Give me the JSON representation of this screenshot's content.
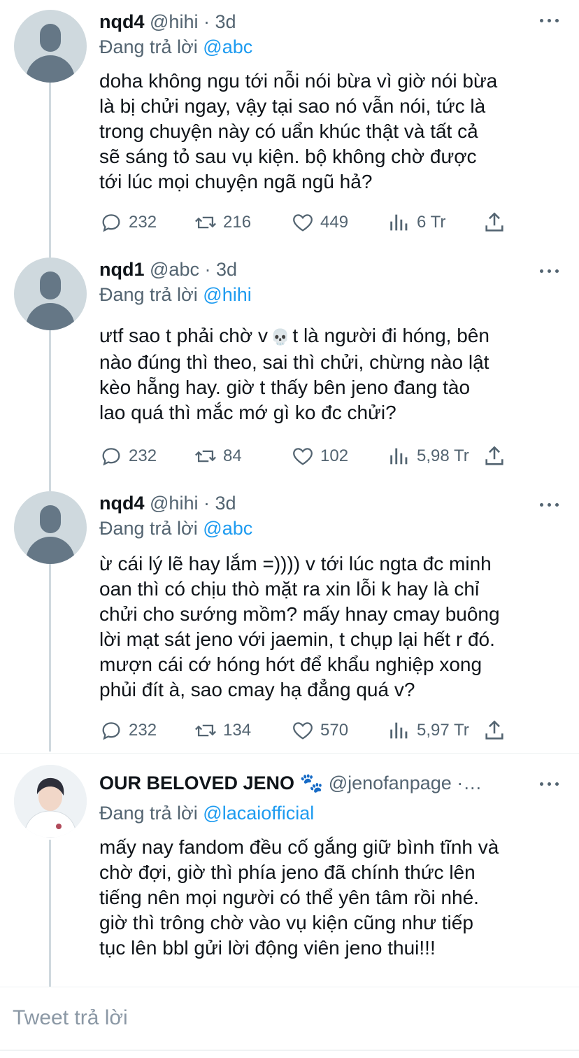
{
  "tweets": [
    {
      "name": "nqd4",
      "handle": "@hihi",
      "dot": "·",
      "time": "3d",
      "replying_prefix": "Đang trả lời",
      "replying_to": "@abc",
      "text_lines": [
        "doha không ngu tới nỗi nói bừa vì giờ nói bừa",
        "là bị chửi ngay, vậy tại sao nó vẫn nói, tức là",
        "trong chuyện này có uẩn khúc thật và tất cả",
        "sẽ sáng tỏ sau vụ kiện. bộ không chờ được",
        "tới lúc mọi chuyện ngã ngũ hả?"
      ],
      "replies": "232",
      "retweets": "216",
      "likes": "449",
      "views": "6 Tr"
    },
    {
      "name": "nqd1",
      "handle": "@abc",
      "dot": "·",
      "time": "3d",
      "replying_prefix": "Đang trả lời",
      "replying_to": "@hihi",
      "text_line1_a": "ưtf sao t phải chờ v",
      "text_line1_emoji": "💀",
      "text_line1_b": "t là người đi hóng, bên",
      "text_lines": [
        "nào đúng thì theo, sai thì chửi, chừng nào lật",
        "kèo hẵng hay. giờ t thấy bên jeno đang tào",
        "lao quá thì mắc mớ gì ko đc chửi?"
      ],
      "replies": "232",
      "retweets": "84",
      "likes": "102",
      "views": "5,98 Tr"
    },
    {
      "name": "nqd4",
      "handle": "@hihi",
      "dot": "·",
      "time": "3d",
      "replying_prefix": "Đang trả lời",
      "replying_to": "@abc",
      "text_lines": [
        "ừ cái lý lẽ hay lắm =)))) v tới lúc ngta đc minh",
        "oan thì có chịu thò mặt ra xin lỗi k hay là chỉ",
        "chửi cho sướng mồm? mấy hnay cmay buông",
        "lời mạt sát jeno với jaemin, t chụp lại hết r đó.",
        "mượn cái cớ hóng hớt để khẩu nghiệp xong",
        "phủi đít à, sao cmay hạ đẳng quá v?"
      ],
      "replies": "232",
      "retweets": "134",
      "likes": "570",
      "views": "5,97 Tr"
    },
    {
      "name": "OUR BELOVED JENO",
      "name_emoji": "🐾",
      "handle": "@jenofanpage",
      "dot": "·…",
      "replying_prefix": "Đang trả lời",
      "replying_to": "@lacaiofficial",
      "text_lines": [
        "mấy nay fandom đều cố gắng giữ bình tĩnh và",
        "chờ đợi, giờ thì phía jeno đã chính thức lên",
        "tiếng nên mọi người có thể yên tâm rồi nhé.",
        "giờ thì trông chờ vào vụ kiện cũng như tiếp",
        "tục lên bbl gửi lời động viên jeno thui!!!"
      ]
    }
  ],
  "reply_box": {
    "placeholder": "Tweet trả lời"
  },
  "icons": {
    "reply": "reply-icon",
    "retweet": "retweet-icon",
    "like": "heart-icon",
    "views": "views-icon",
    "share": "share-icon",
    "more": "more-icon"
  },
  "colors": {
    "accent": "#1d9bf0",
    "muted": "#536471",
    "text": "#0f1419"
  }
}
